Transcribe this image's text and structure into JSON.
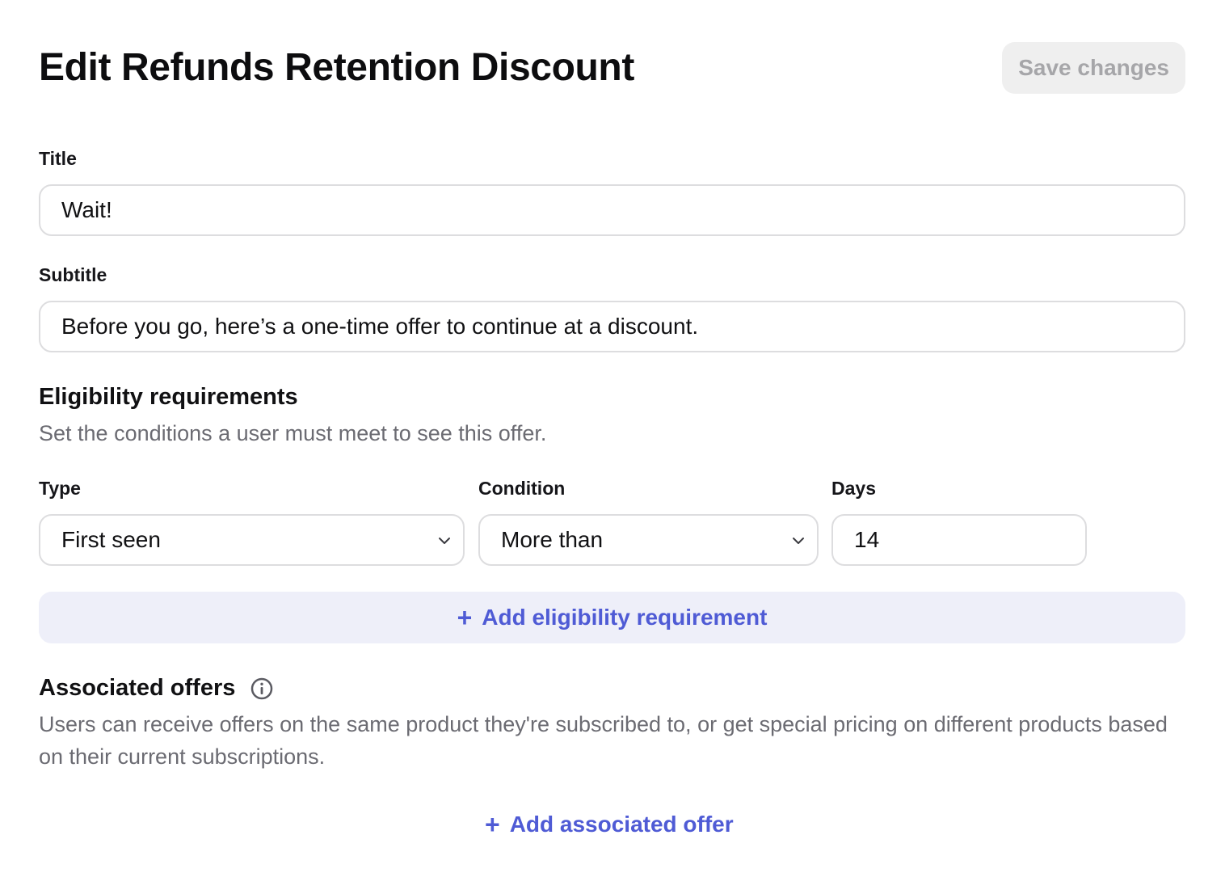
{
  "header": {
    "title": "Edit Refunds Retention Discount",
    "save_label": "Save changes"
  },
  "form": {
    "title_label": "Title",
    "title_value": "Wait!",
    "subtitle_label": "Subtitle",
    "subtitle_value": "Before you go, here’s a one-time offer to continue at a discount."
  },
  "eligibility": {
    "heading": "Eligibility requirements",
    "description": "Set the conditions a user must meet to see this offer.",
    "type_label": "Type",
    "type_value": "First seen",
    "condition_label": "Condition",
    "condition_value": "More than",
    "days_label": "Days",
    "days_value": "14",
    "add_label": "Add eligibility requirement"
  },
  "associated_offers": {
    "heading": "Associated offers",
    "description": "Users can receive offers on the same product they're subscribed to, or get special pricing on different products based on their current subscriptions.",
    "add_label": "Add associated offer"
  },
  "colors": {
    "accent": "#4f5bd5",
    "accent_bg": "#eeeff9",
    "border": "#dddddf",
    "muted_text": "#6b6b72",
    "disabled_button_bg": "#efefef",
    "disabled_button_text": "#a6a6a9"
  },
  "icons": {
    "plus": "plus-icon",
    "chevron": "chevron-down-icon",
    "info": "info-icon"
  }
}
